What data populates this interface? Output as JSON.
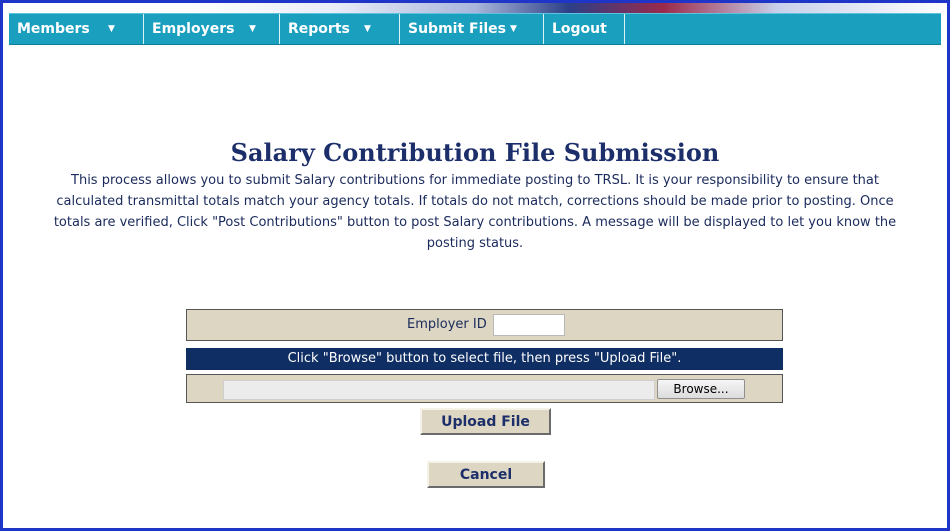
{
  "nav": {
    "items": [
      {
        "label": "Members",
        "caret": "▼"
      },
      {
        "label": "Employers",
        "caret": "▼"
      },
      {
        "label": "Reports",
        "caret": "▼"
      },
      {
        "label": "Submit Files",
        "caret": "▼"
      },
      {
        "label": "Logout"
      }
    ]
  },
  "page": {
    "title": "Salary Contribution File Submission",
    "description": "This process allows you to submit Salary contributions for immediate posting to TRSL. It is your responsibility to ensure that calculated transmittal totals match your agency totals. If totals do not match, corrections should be made prior to posting. Once totals are verified, Click \"Post Contributions\" button to post Salary contributions. A message will be displayed to let you know the posting status."
  },
  "form": {
    "employer_id_label": "Employer ID",
    "employer_id_value": "",
    "instruction": "Click \"Browse\" button to select file, then press \"Upload File\".",
    "file_value": "",
    "browse_label": "Browse...",
    "upload_label": "Upload File",
    "cancel_label": "Cancel"
  },
  "colors": {
    "nav_bg": "#1a9fbf",
    "title_color": "#1d2f6a",
    "panel_bg": "#dcd6c2",
    "instruction_bg": "#0f2e63",
    "frame_border": "#1f35c8"
  }
}
